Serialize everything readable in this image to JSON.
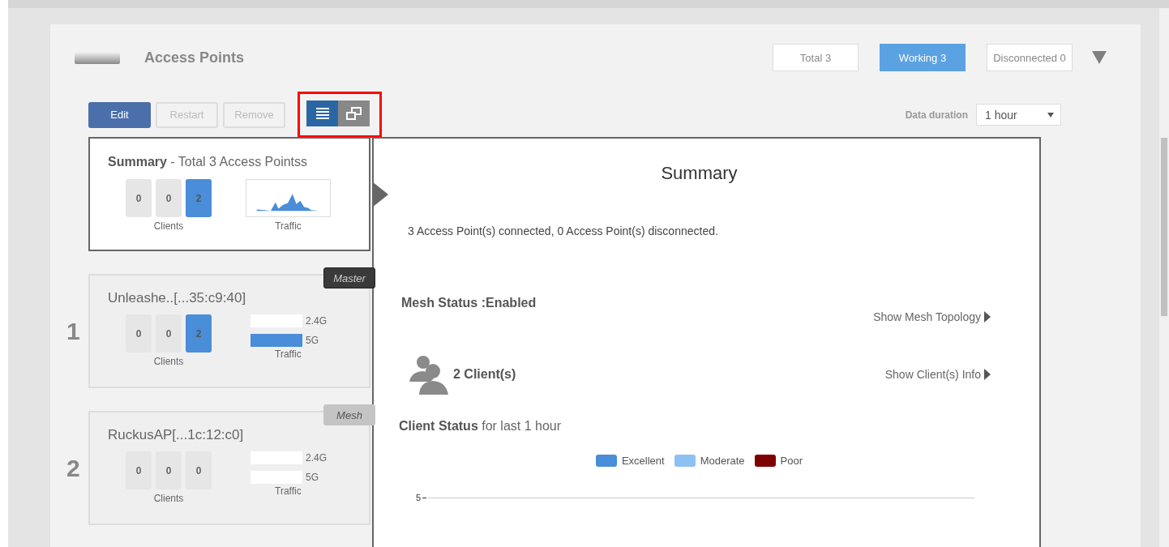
{
  "header": {
    "title": "Access Points"
  },
  "filters": [
    {
      "label": "Total 3",
      "selected": false
    },
    {
      "label": "Working 3",
      "selected": true
    },
    {
      "label": "Disconnected 0",
      "selected": false
    }
  ],
  "toolbar": {
    "buttons": [
      {
        "label": "Edit",
        "disabled": false
      },
      {
        "label": "Restart",
        "disabled": true
      },
      {
        "label": "Remove",
        "disabled": true
      }
    ],
    "views": [
      {
        "kind": "list",
        "selected": true
      },
      {
        "kind": "windows",
        "selected": false
      }
    ],
    "duration_label": "Data duration",
    "duration": "1 hour"
  },
  "summary_card": {
    "title": "**Summary** - Total 3 Access Pointss",
    "selected": true,
    "clients": [
      {
        "value": "0",
        "active": false
      },
      {
        "value": "0",
        "active": false
      },
      {
        "value": "2",
        "active": true
      }
    ],
    "clients_label": "Clients",
    "traffic_label": "Traffic"
  },
  "access_points": [
    {
      "index": "1",
      "name": "Unleashe..[...35:c9:40]",
      "role": "Master",
      "kind": "master",
      "selected": false,
      "clients": [
        {
          "value": "0",
          "active": false
        },
        {
          "value": "0",
          "active": false
        },
        {
          "value": "2",
          "active": true
        }
      ],
      "bands": [
        {
          "label": "2.4G",
          "level": 0
        },
        {
          "label": "5G",
          "level": 1
        }
      ],
      "clients_label": "Clients",
      "traffic_label": "Traffic"
    },
    {
      "index": "2",
      "name": "RuckusAP[...1c:12:c0]",
      "role": "Mesh",
      "kind": "mesh",
      "selected": false,
      "clients": [
        {
          "value": "0",
          "active": false
        },
        {
          "value": "0",
          "active": false
        },
        {
          "value": "0",
          "active": false
        }
      ],
      "bands": [
        {
          "label": "2.4G",
          "level": 0
        },
        {
          "label": "5G",
          "level": 0
        }
      ],
      "clients_label": "Clients",
      "traffic_label": "Traffic"
    }
  ],
  "detail": {
    "title": "Summary",
    "status_text": "3 Access Point(s) connected, 0 Access Point(s) disconnected.",
    "mesh_status": "Mesh Status :Enabled",
    "mesh_link": "Show Mesh Topology",
    "clients_count": "2 Client(s)",
    "clients_link": "Show Client(s) Info",
    "chart_title": "**Client Status** for last 1 hour",
    "legend": [
      {
        "label": "Excellent",
        "color": "#4a8dd8"
      },
      {
        "label": "Moderate",
        "color": "#8ec1f3"
      },
      {
        "label": "Poor",
        "color": "#7f0000"
      }
    ],
    "y_tick": "5"
  }
}
